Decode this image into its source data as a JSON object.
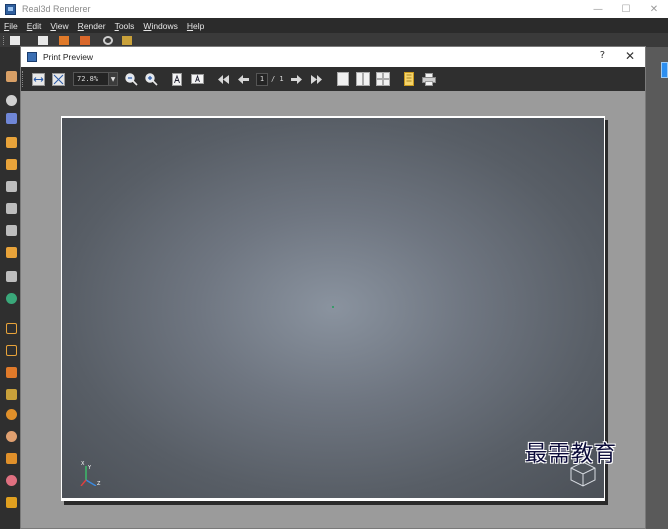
{
  "app": {
    "title": "Real3d Renderer",
    "window_controls": [
      "—",
      "☐",
      "✕"
    ]
  },
  "menubar": {
    "items": [
      {
        "first": "F",
        "rest": "ile"
      },
      {
        "first": "E",
        "rest": "dit"
      },
      {
        "first": "V",
        "rest": "iew"
      },
      {
        "first": "R",
        "rest": "ender"
      },
      {
        "first": "T",
        "rest": "ools"
      },
      {
        "first": "W",
        "rest": "indows"
      },
      {
        "first": "H",
        "rest": "elp"
      }
    ]
  },
  "dialog": {
    "title": "Print Preview",
    "help_label": "?",
    "close_label": "✕"
  },
  "preview_toolbar": {
    "zoom_value": "72.8%",
    "page_current": "1",
    "page_total": "/ 1"
  },
  "viewport": {
    "axis_labels": {
      "y": "Y",
      "x": "X",
      "z": "Z"
    }
  },
  "watermark": "最需教育",
  "colors": {
    "accent": "#2d8ff0",
    "dark_toolbar": "#2f2f2f",
    "preview_bg": "#9b9b9b"
  }
}
